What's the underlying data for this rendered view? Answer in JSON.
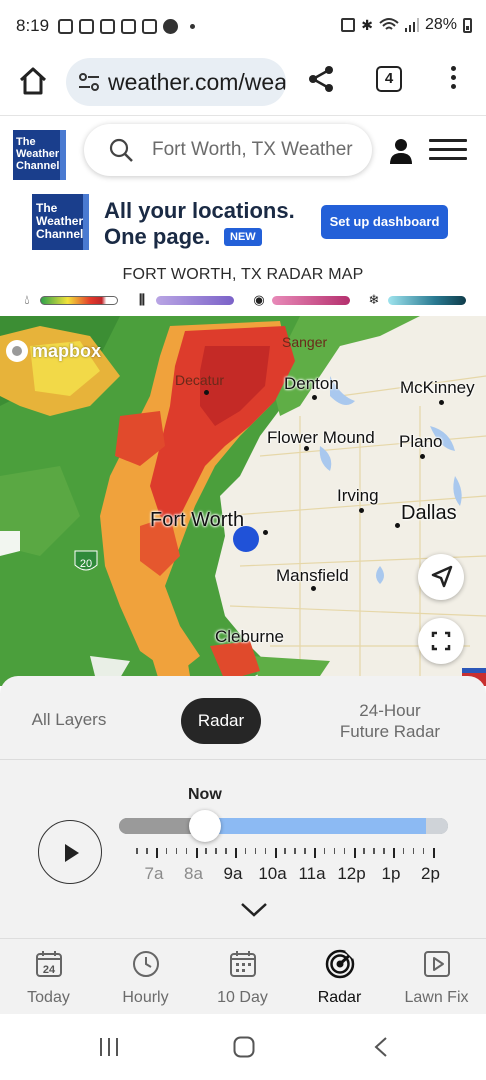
{
  "status_bar": {
    "time": "8:19",
    "battery": "28%"
  },
  "browser": {
    "url": "weather.com/weather/radar",
    "tab_count": "4"
  },
  "header": {
    "logo_lines": [
      "The",
      "Weather",
      "Channel"
    ],
    "search_text": "Fort Worth, TX Weather"
  },
  "ad": {
    "line1": "All your locations.",
    "line2": "One page.",
    "badge": "NEW",
    "cta": "Set up dashboard"
  },
  "radar": {
    "title": "FORT WORTH, TX RADAR MAP",
    "legend": [
      {
        "name": "rain-icon",
        "colors": [
          "#2fa24a",
          "#f2e23a",
          "#e33a2a",
          "#c0262a",
          "#ffffff"
        ]
      },
      {
        "name": "ice-icon",
        "colors": [
          "#a78bd6",
          "#7b62c8"
        ]
      },
      {
        "name": "mix-icon",
        "colors": [
          "#e06aa8",
          "#b5306e"
        ]
      },
      {
        "name": "snow-icon",
        "colors": [
          "#9fe4ee",
          "#2a7a92",
          "#0f3c4a"
        ]
      }
    ]
  },
  "map": {
    "attribution": "mapbox",
    "cities": [
      {
        "name": "Sanger",
        "style": "dim"
      },
      {
        "name": "Decatur",
        "style": "dim"
      },
      {
        "name": "Denton",
        "style": "normal"
      },
      {
        "name": "McKinney",
        "style": "normal"
      },
      {
        "name": "Flower Mound",
        "style": "normal"
      },
      {
        "name": "Plano",
        "style": "normal"
      },
      {
        "name": "Irving",
        "style": "normal"
      },
      {
        "name": "Fort Worth",
        "style": "big"
      },
      {
        "name": "Dallas",
        "style": "big"
      },
      {
        "name": "Mansfield",
        "style": "normal"
      },
      {
        "name": "Cleburne",
        "style": "normal"
      }
    ],
    "highway_shield": "20"
  },
  "layers": {
    "tabs": [
      "All Layers",
      "Radar",
      "24-Hour\nFuture Radar"
    ],
    "active": "Radar"
  },
  "timeline": {
    "current_label": "Now",
    "labels": [
      "7a",
      "8a",
      "9a",
      "10a",
      "11a",
      "12p",
      "1p",
      "2p"
    ],
    "past_count": 2
  },
  "bottom_nav": {
    "items": [
      {
        "label": "Today",
        "icon": "calendar-today-icon",
        "badge": "24"
      },
      {
        "label": "Hourly",
        "icon": "clock-icon"
      },
      {
        "label": "10 Day",
        "icon": "calendar-grid-icon"
      },
      {
        "label": "Radar",
        "icon": "radar-icon"
      },
      {
        "label": "Lawn Fix",
        "icon": "video-icon"
      }
    ],
    "active": "Radar"
  }
}
